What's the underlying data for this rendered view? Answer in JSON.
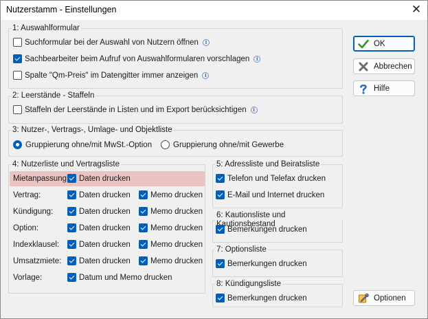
{
  "window": {
    "title": "Nutzerstamm - Einstellungen",
    "close_glyph": "✕"
  },
  "groups": {
    "auswahlformular": {
      "legend": "1: Auswahlformular",
      "items": [
        {
          "label": "Suchformular bei der Auswahl von Nutzern öffnen",
          "checked": false
        },
        {
          "label": "Sachbearbeiter beim Aufruf von Auswahlformularen vorschlagen",
          "checked": true
        },
        {
          "label": "Spalte \"Qm-Preis\" im Datengitter immer anzeigen",
          "checked": false
        }
      ]
    },
    "leerstaende": {
      "legend": "2: Leerstände - Staffeln",
      "items": [
        {
          "label": "Staffeln der Leerstände in Listen und im Export berücksichtigen",
          "checked": false
        }
      ]
    },
    "nutzerliste_gruppierung": {
      "legend": "3: Nutzer-, Vertrags-, Umlage- und Objektliste",
      "options": [
        "Gruppierung ohne/mit MwSt.-Option",
        "Gruppierung ohne/mit Gewerbe"
      ],
      "selected": 0
    },
    "vertragsliste": {
      "legend": "4: Nutzerliste und Vertragsliste",
      "rows": [
        {
          "label": "Mietanpassung:",
          "a": "Daten drucken",
          "b": null
        },
        {
          "label": "Vertrag:",
          "a": "Daten drucken",
          "b": "Memo drucken"
        },
        {
          "label": "Kündigung:",
          "a": "Daten drucken",
          "b": "Memo drucken"
        },
        {
          "label": "Option:",
          "a": "Daten drucken",
          "b": "Memo drucken"
        },
        {
          "label": "Indexklausel:",
          "a": "Daten drucken",
          "b": "Memo drucken"
        },
        {
          "label": "Umsatzmiete:",
          "a": "Daten drucken",
          "b": "Memo drucken"
        },
        {
          "label": "Vorlage:",
          "a": "Datum und Memo drucken",
          "b": null
        }
      ]
    },
    "adressliste": {
      "legend": "5: Adressliste und Beiratsliste",
      "items": [
        {
          "label": "Telefon und Telefax drucken",
          "checked": true
        },
        {
          "label": "E-Mail und Internet drucken",
          "checked": true
        }
      ]
    },
    "kautionsliste": {
      "legend": "6: Kautionsliste und Kautionsbestand",
      "items": [
        {
          "label": "Bemerkungen drucken",
          "checked": true
        }
      ]
    },
    "optionsliste": {
      "legend": "7: Optionsliste",
      "items": [
        {
          "label": "Bemerkungen drucken",
          "checked": true
        }
      ]
    },
    "kuendigungsliste": {
      "legend": "8: Kündigungsliste",
      "items": [
        {
          "label": "Bemerkungen drucken",
          "checked": true
        }
      ]
    }
  },
  "buttons": {
    "ok": "OK",
    "cancel": "Abbrechen",
    "help": "Hilfe",
    "options": "Optionen"
  },
  "colors": {
    "accent": "#005fb8",
    "highlight": "#ebc4c2",
    "background": "#f0f0f0"
  },
  "icons": {
    "info": "info-icon",
    "ok": "checkmark-icon",
    "cancel": "x-icon",
    "help": "question-icon",
    "options": "wrench-icon"
  }
}
